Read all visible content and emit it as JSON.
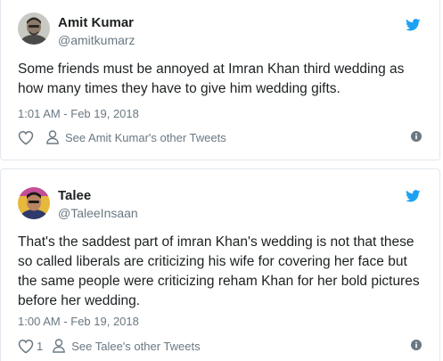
{
  "tweets": [
    {
      "name": "Amit Kumar",
      "handle": "@amitkumarz",
      "text": "Some friends must be annoyed at Imran Khan third wedding as how many times they have to give him wedding gifts.",
      "timestamp": "1:01 AM - Feb 19, 2018",
      "likes": "",
      "other_tweets": "See Amit Kumar's other Tweets"
    },
    {
      "name": "Talee",
      "handle": "@TaleeInsaan",
      "text": "That's the saddest part of imran Khan's wedding is not that these so called liberals are criticizing his wife for covering her face but the same people were criticizing reham Khan for her bold pictures before her wedding.",
      "timestamp": "1:00 AM - Feb 19, 2018",
      "likes": "1",
      "other_tweets": "See Talee's other Tweets"
    }
  ],
  "icons": {
    "brand": "twitter-bird-icon",
    "like": "heart-icon",
    "profile": "person-icon",
    "info": "info-icon"
  },
  "colors": {
    "twitter_blue": "#1da1f2",
    "text": "#1c2022",
    "muted": "#697882",
    "border": "#e1e8ed"
  }
}
